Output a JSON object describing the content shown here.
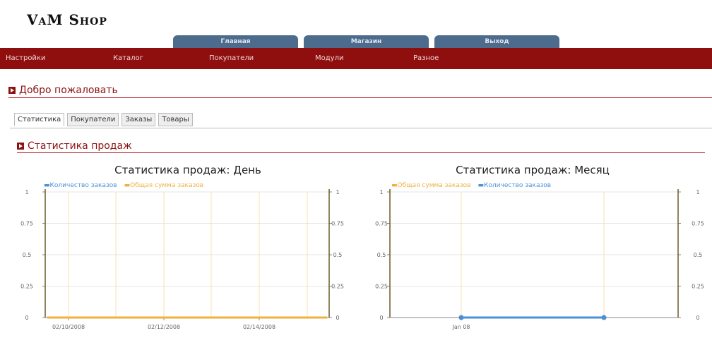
{
  "logo": "VaM Shop",
  "top_tabs": [
    "Главная",
    "Магазин",
    "Выход"
  ],
  "menu": [
    "Настройки",
    "Каталог",
    "Покупатели",
    "Модули",
    "Разное"
  ],
  "welcome": "Добро пожаловать",
  "tabs": [
    "Статистика",
    "Покупатели",
    "Заказы",
    "Товары"
  ],
  "stats_title": "Статистика продаж",
  "legend": {
    "orders": "Количество заказов",
    "sum": "Общая сумма заказов"
  },
  "colors": {
    "orders": "#4a90d9",
    "sum": "#f0b040",
    "menu_bg": "#8f0f0f",
    "tab_bg": "#4d6b8c"
  },
  "chart_data": [
    {
      "type": "line",
      "title": "Статистика продаж: День",
      "x_labels": [
        "02/10/2008",
        "02/12/2008",
        "02/14/2008"
      ],
      "ylim": [
        0,
        1
      ],
      "y_ticks": [
        "0",
        "0.25",
        "0.5",
        "0.75",
        "1"
      ],
      "series": [
        {
          "name": "Количество заказов",
          "values": [
            0,
            0,
            0,
            0,
            0,
            0,
            0
          ]
        },
        {
          "name": "Общая сумма заказов",
          "values": [
            0,
            0,
            0,
            0,
            0,
            0,
            0
          ]
        }
      ]
    },
    {
      "type": "line",
      "title": "Статистика продаж: Месяц",
      "x_labels": [
        "Jan 08"
      ],
      "ylim": [
        0,
        1
      ],
      "y_ticks": [
        "0",
        "0.25",
        "0.5",
        "0.75",
        "1"
      ],
      "series": [
        {
          "name": "Общая сумма заказов",
          "values": [
            0,
            0
          ]
        },
        {
          "name": "Количество заказов",
          "values": [
            0,
            0
          ]
        }
      ]
    }
  ]
}
